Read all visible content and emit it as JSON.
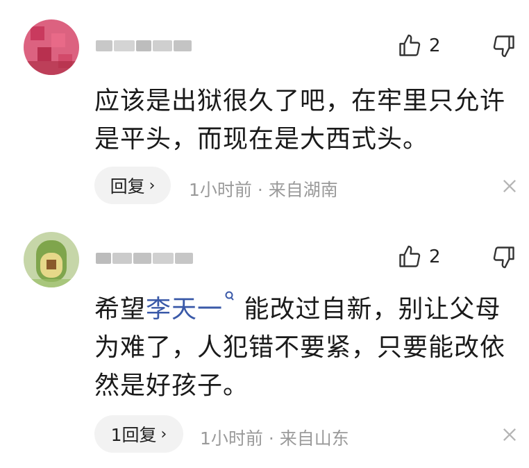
{
  "comments": [
    {
      "likes": "2",
      "text_lines": [
        "应该是出狱很久了吧，在牢里只允许",
        "是平头，而现在是大西式头。"
      ],
      "reply_label": "回复",
      "time": "1小时前",
      "location": "来自湖南",
      "avatar_color": "#d94b6e"
    },
    {
      "likes": "2",
      "text_before_mention": "希望",
      "mention": "李天一",
      "text_after_mention": " 能改过自新，别让父母",
      "text_line2": "为难了，人犯错不要紧，只要能改依",
      "text_line3": "然是好孩子。",
      "reply_label": "1回复",
      "time": "1小时前",
      "location": "来自山东",
      "avatar_color": "#7fa54c"
    }
  ],
  "colors": {
    "mention": "#3a59a8",
    "meta": "#9a9a9a",
    "pill": "#f2f2f2"
  },
  "icons": [
    "thumb-up-icon",
    "thumb-down-icon",
    "close-icon",
    "search-icon",
    "chevron-right-icon"
  ]
}
